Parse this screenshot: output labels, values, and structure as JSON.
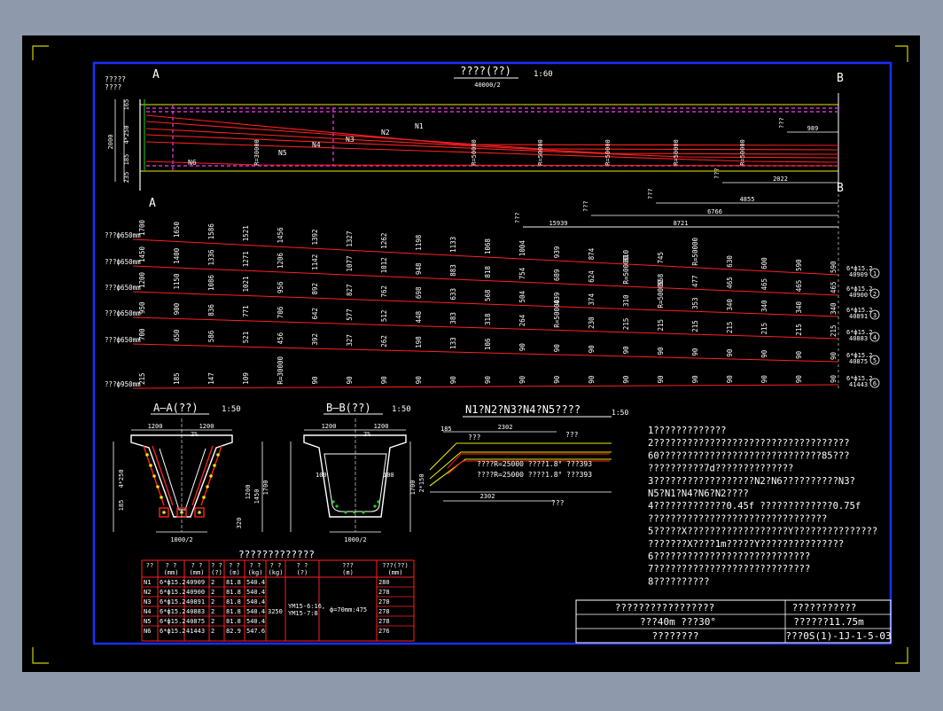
{
  "section_titles": {
    "elevation": "????(??)",
    "elevation_scale": "1:60",
    "elevation_span": "40000/2",
    "section_aa": "A—A(??)",
    "section_aa_scale": "1:50",
    "section_bb": "B—B(??)",
    "section_bb_scale": "1:50",
    "bend_detail": "N1?N2?N3?N4?N5????",
    "bend_detail_scale": "1:50",
    "quantity_table": "?????????????"
  },
  "markers": {
    "a_top": "A",
    "a_bottom": "A",
    "b_top": "B",
    "b_bottom": "B",
    "left_note": "?????\n????"
  },
  "tendon_labels": [
    "N1",
    "N2",
    "N3",
    "N4",
    "N5",
    "N6"
  ],
  "curve_labels": [
    "R=30000",
    "R=50000",
    "R=50000",
    "R=50000",
    "R=50000",
    "R=50000"
  ],
  "elev_left_dims": [
    "2000",
    "4*250",
    "185",
    "235",
    "165"
  ],
  "elev_right_dims": [
    "989",
    "2022",
    "4855",
    "6766",
    "8721",
    "15939"
  ],
  "elev_right_labels": [
    "???",
    "???",
    "???",
    "???",
    "???"
  ],
  "ordinate_rows": [
    {
      "label": "???ф650mm",
      "values": [
        "1700",
        "1650",
        "1586",
        "1521",
        "1456",
        "1392",
        "1327",
        "1262",
        "1198",
        "1133",
        "1068",
        "1004",
        "939",
        "874",
        "810",
        "745",
        "R=50000",
        "630",
        "600",
        "590",
        "590"
      ],
      "tag": "6*ф15.2",
      "len": "40909",
      "id": "1"
    },
    {
      "label": "???ф650mm",
      "values": [
        "1450",
        "1400",
        "1336",
        "1271",
        "1206",
        "1142",
        "1077",
        "1012",
        "948",
        "883",
        "818",
        "754",
        "689",
        "624",
        "R=50000",
        "558",
        "477",
        "465",
        "465",
        "465",
        "465"
      ],
      "tag": "6*ф15.2",
      "len": "40900",
      "id": "2"
    },
    {
      "label": "???ф650mm",
      "values": [
        "1200",
        "1150",
        "1086",
        "1021",
        "956",
        "892",
        "827",
        "762",
        "698",
        "633",
        "568",
        "504",
        "439",
        "374",
        "310",
        "R=50000",
        "353",
        "340",
        "340",
        "340",
        "340"
      ],
      "tag": "6*ф15.2",
      "len": "40891",
      "id": "3"
    },
    {
      "label": "???ф650mm",
      "values": [
        "950",
        "900",
        "836",
        "771",
        "706",
        "642",
        "577",
        "512",
        "448",
        "383",
        "318",
        "264",
        "R=50000",
        "230",
        "215",
        "215",
        "215",
        "215",
        "215",
        "215",
        "215"
      ],
      "tag": "6*ф15.2",
      "len": "40883",
      "id": "4"
    },
    {
      "label": "???ф650mm",
      "values": [
        "700",
        "650",
        "586",
        "521",
        "456",
        "392",
        "327",
        "262",
        "198",
        "133",
        "106",
        "90",
        "90",
        "90",
        "90",
        "90",
        "90",
        "90",
        "90",
        "90",
        "90"
      ],
      "tag": "6*ф15.2",
      "len": "40875",
      "id": "5"
    },
    {
      "label": "???ф950mm",
      "values": [
        "215",
        "185",
        "147",
        "109",
        "R=30000",
        "90",
        "90",
        "90",
        "90",
        "90",
        "90",
        "90",
        "90",
        "90",
        "90",
        "90",
        "90",
        "90",
        "90",
        "90",
        "90"
      ],
      "tag": "6*ф15.2",
      "len": "41443",
      "id": "6"
    }
  ],
  "section_aa_dims": {
    "top_left": "1200",
    "top_right": "1200",
    "center": "2%",
    "d1": "4*250",
    "d2": "185",
    "d3": "1700",
    "d4": "1200",
    "d5": "1450",
    "d6": "320",
    "bottom": "1000/2"
  },
  "section_bb_dims": {
    "top_left": "1200",
    "top_right": "1200",
    "center": "2%",
    "d1": "1700",
    "d2": "100",
    "d3": "100",
    "bottom": "1000/2"
  },
  "bend_dims": {
    "top": "2302",
    "bottom": "2302",
    "r1": "????R=25000 ????1.8° ???393",
    "r2": "????R=25000 ????1.8° ???393",
    "left": "185",
    "h": "2*150",
    "n1": "???",
    "n2": "???",
    "n3": "???"
  },
  "notes": [
    "1?????????????",
    "2???????????????????????????????????",
    "60?????????????????????????????85???",
    "??????????7d??????????????",
    "3??????????????????N2?N6??????????N3?",
    "N5?N1?N4?N6?N2????",
    "4?????????????0.45f    ?????????????0.75f",
    "????????????????????????????????",
    "5?????X??????????????????Y???????????????",
    "???????X????1m?????Y???????????????",
    "6????????????????????????????",
    "7????????????????????????????",
    "8??????????"
  ],
  "quantity": {
    "headers": [
      "??",
      "? ?\n(mm)",
      "? ?\n(mm)",
      "? ?\n(?)",
      "? ?\n(m)",
      "? ?\n(kg)",
      "? ?\n(kg)",
      "? ?\n(?)",
      "???\n(m)",
      "???(??)\n(mm)"
    ],
    "rows": [
      [
        "N1",
        "6*ф15.2",
        "40909",
        "2",
        "81.8",
        "540.4",
        "",
        "",
        "",
        "280"
      ],
      [
        "N2",
        "6*ф15.2",
        "40900",
        "2",
        "81.8",
        "540.4",
        "",
        "",
        "",
        "278"
      ],
      [
        "N3",
        "6*ф15.2",
        "40891",
        "2",
        "81.8",
        "540.4",
        "",
        "",
        "",
        "278"
      ],
      [
        "N4",
        "6*ф15.2",
        "40883",
        "2",
        "81.8",
        "540.4",
        "",
        "",
        "",
        "278"
      ],
      [
        "N5",
        "6*ф15.2",
        "40875",
        "2",
        "81.8",
        "540.4",
        "",
        "",
        "",
        "278"
      ],
      [
        "N6",
        "6*ф15.2",
        "41443",
        "2",
        "82.9",
        "547.6",
        "",
        "",
        "",
        "276"
      ]
    ],
    "merged_total": "3250",
    "merged_anchor": "YM15-6:16,\nYM15-7:8",
    "merged_duct": "ф=70mm:475"
  },
  "title_block": {
    "row1_left": "?????????????????",
    "row1_right": "???????????",
    "row2_left": "???40m     ???30°",
    "row2_right": "??????11.75m",
    "row3_left": "????????",
    "row3_right": "???0S(1)-1J-1-5-03"
  },
  "colors": {
    "background_outer": "#8e9aab",
    "drawing_bg": "#000000",
    "viewport_frame": "#1a2fff",
    "tendon": "#ff2020",
    "magenta": "#d030d0",
    "text": "#ffffff",
    "yellow": "#e8e800",
    "green": "#20d020"
  }
}
